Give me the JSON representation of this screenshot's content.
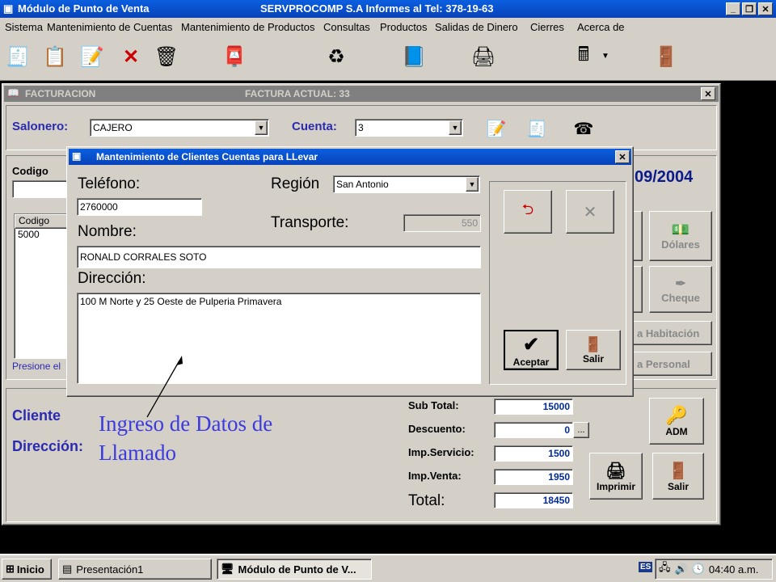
{
  "app": {
    "title": "Módulo de Punto de Venta",
    "title_center": "SERVPROCOMP S.A  Informes al Tel:  378-19-63"
  },
  "menu": [
    "Sistema",
    "Mantenimiento de Cuentas",
    "Mantenimiento de Productos",
    "Consultas",
    "Productos",
    "Salidas de Dinero",
    "Cierres",
    "Acerca de"
  ],
  "toolbar_icons": [
    "cash-register-icon",
    "notepad-icon",
    "edit-document-icon",
    "delete-x-icon",
    "wastebasket-icon",
    "stamp-icon",
    "recycle-bin-icon",
    "book-folder-icon",
    "printer-icon",
    "calculator-window-icon",
    "exit-door-icon"
  ],
  "factura": {
    "title": "FACTURACION",
    "factura_actual": "FACTURA ACTUAL:  33",
    "salonero_label": "Salonero:",
    "salonero_value": "CAJERO",
    "cuenta_label": "Cuenta:",
    "cuenta_value": "3",
    "codigo_label": "Codigo",
    "list_header": "Codigo",
    "list_item": "5000",
    "presione": "Presione el",
    "date_partial": "09/2004",
    "dolares": "Dólares",
    "cheque": "Cheque",
    "habitacion": "a Habitación",
    "personal": "a Personal",
    "cliente_label": "Cliente",
    "direccion_label": "Dirección:",
    "subtotal_label": "Sub Total:",
    "subtotal": "15000",
    "descuento_label": "Descuento:",
    "descuento": "0",
    "dots": "...",
    "impserv_label": "Imp.Servicio:",
    "impserv": "1500",
    "impventa_label": "Imp.Venta:",
    "impventa": "1950",
    "total_label": "Total:",
    "total": "18450",
    "adm": "ADM",
    "imprimir": "Imprimir",
    "salir": "Salir"
  },
  "dialog": {
    "title": "Mantenimiento de Clientes Cuentas para LLevar",
    "telefono_label": "Teléfono:",
    "telefono": "2760000",
    "region_label": "Región",
    "region": "San Antonio",
    "transporte_label": "Transporte:",
    "transporte": "550",
    "nombre_label": "Nombre:",
    "nombre": "RONALD CORRALES SOTO",
    "direccion_label": "Dirección:",
    "direccion": "100 M Norte y 25 Oeste de Pulperia Primavera",
    "aceptar": "Aceptar",
    "salir": "Salir"
  },
  "annotation": "Ingreso de Datos de Llamado",
  "taskbar": {
    "start": "Inicio",
    "task1": "Presentación1",
    "task2": "Módulo de Punto de V...",
    "lang": "ES",
    "clock": "04:40 a.m."
  },
  "colors": {
    "title_blue": "#0842b8",
    "label_blue": "#2a2ab0",
    "annotation": "#3a3ae0"
  }
}
